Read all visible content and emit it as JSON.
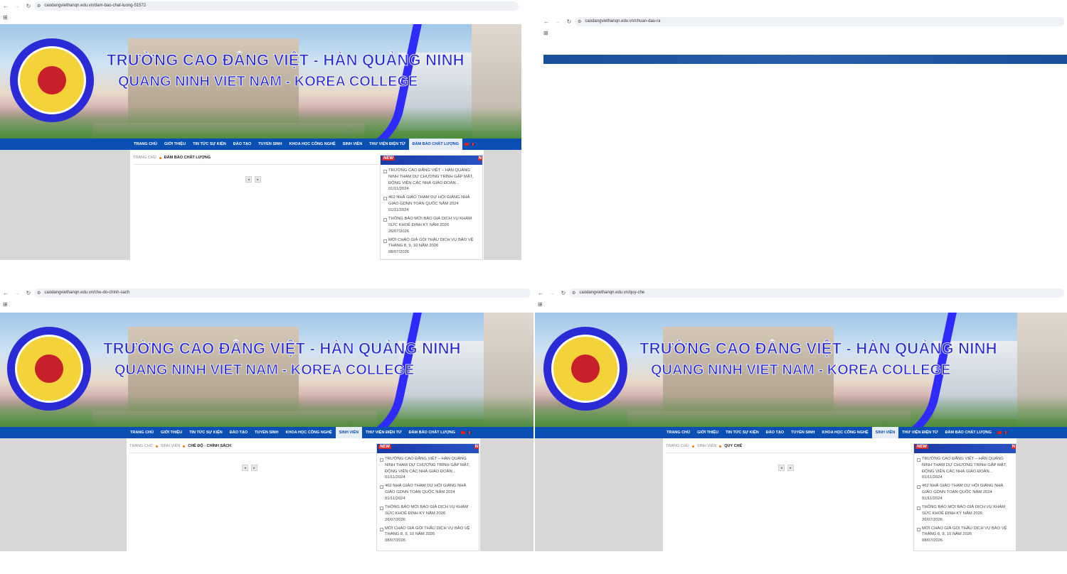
{
  "site": {
    "banner_title": "TRƯỜNG CAO ĐẲNG VIỆT - HÀN QUẢNG NINH",
    "banner_subtitle": "QUANG NINH VIET NAM - KOREA COLLEGE",
    "menu": [
      "TRANG CHỦ",
      "GIỚI THIỆU",
      "TIN TỨC SỰ KIỆN",
      "ĐÀO TẠO",
      "TUYỂN SINH",
      "KHOA HỌC CÔNG NGHỆ",
      "SINH VIÊN",
      "THƯ VIỆN ĐIỆN TỬ",
      "ĐẢM BẢO CHẤT LƯỢNG"
    ],
    "news": [
      {
        "title": "TRƯỜNG CAO ĐẲNG VIỆT – HÀN QUẢNG NINH THAM DỰ CHƯƠNG TRÌNH GẶP MẶT, ĐỘNG VIÊN CÁC NHÀ GIÁO ĐOÀN...",
        "date": "01/11/2024"
      },
      {
        "title": "462 NHÀ GIÁO THAM DỰ HỘI GIẢNG NHÀ GIÁO GDNN TOÀN QUỐC NĂM 2024",
        "date": "01/11/2024"
      },
      {
        "title": "THÔNG BÁO MỜI BÁO GIÁ DỊCH VỤ KHÁM SỨC KHOẺ ĐỊNH KỲ NĂM 2026",
        "date": "26/07/2026"
      },
      {
        "title": "MỜI CHÀO GIÁ GÓI THẦU DỊCH VỤ BẢO VỆ THÁNG 8, 9, 10 NĂM 2026",
        "date": "08/07/2026"
      }
    ],
    "news_badge": "NEW",
    "news_badge_right": "N",
    "pager_prev": "◂",
    "pager_next": "▸",
    "colors": {
      "menu_bg": "#0a4fb3",
      "banner_text": "#2a2bd6",
      "breadcrumb_dot": "#f27c00"
    }
  },
  "windows": [
    {
      "url": "caodangviethanqn.edu.vn/dam-bao-chat-luong-51572",
      "active_menu": 8,
      "breadcrumb": [
        "TRANG CHỦ",
        "ĐẢM BẢO CHẤT LƯỢNG"
      ]
    },
    {
      "url": "caodangviethanqn.edu.vn/chuan-dau-ra"
    },
    {
      "url": "caodangviethanqn.edu.vn/che-do-chinh-sach",
      "active_menu": 6,
      "breadcrumb": [
        "TRANG CHỦ",
        "SINH VIÊN",
        "CHẾ ĐỘ - CHÍNH SÁCH"
      ]
    },
    {
      "url": "caodangviethanqn.edu.vn/quy-che",
      "active_menu": 6,
      "breadcrumb": [
        "TRANG CHỦ",
        "SINH VIÊN",
        "QUY CHẾ"
      ]
    }
  ],
  "icons": [
    "back-icon",
    "forward-icon",
    "reload-icon",
    "site-settings-icon",
    "apps-icon"
  ]
}
